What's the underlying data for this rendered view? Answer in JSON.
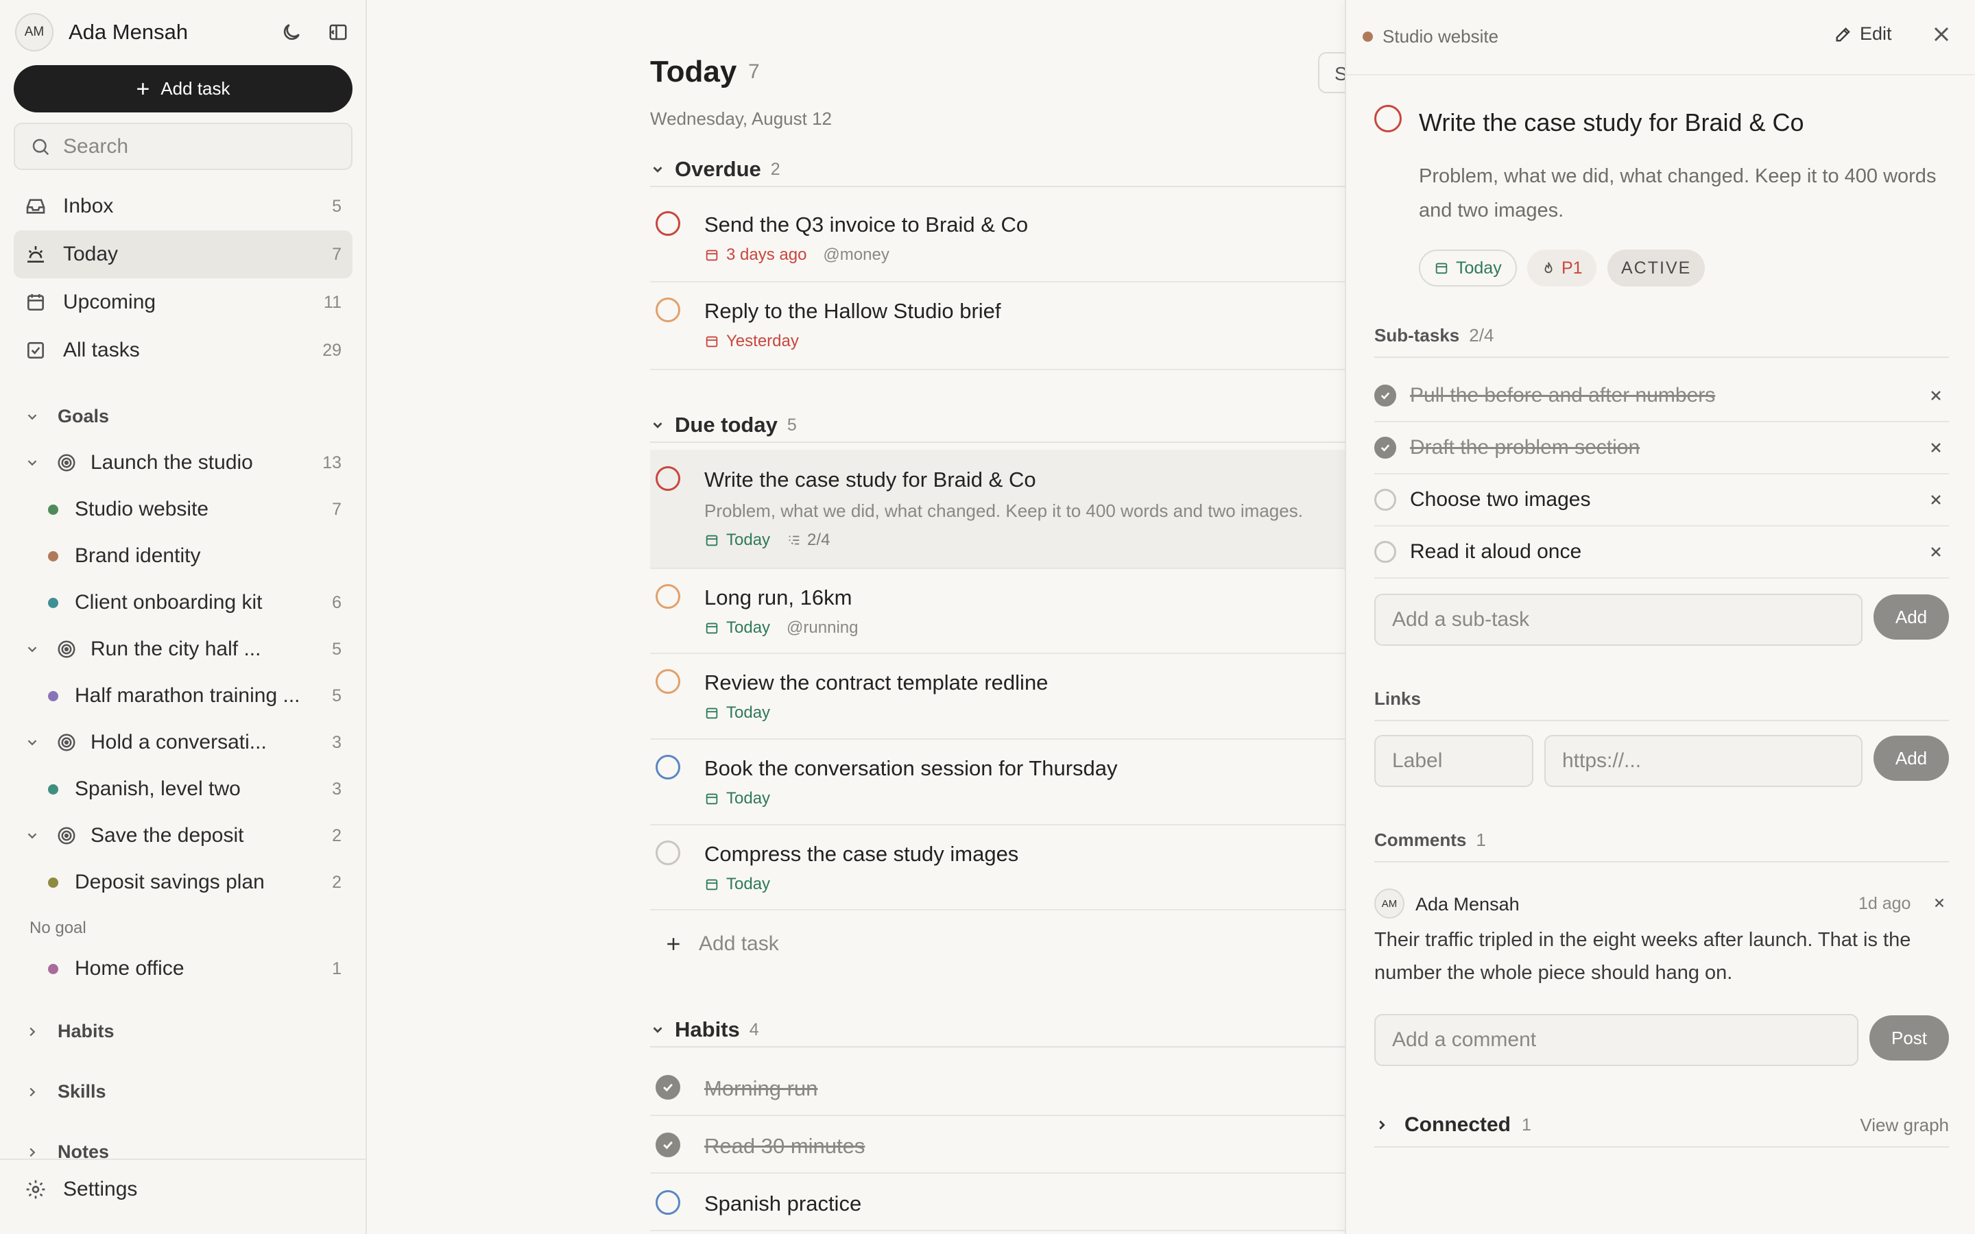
{
  "sidebar": {
    "user_initials": "AM",
    "user_name": "Ada Mensah",
    "add_task_label": "Add task",
    "search_placeholder": "Search",
    "nav": [
      {
        "label": "Inbox",
        "count": "5"
      },
      {
        "label": "Today",
        "count": "7"
      },
      {
        "label": "Upcoming",
        "count": "11"
      },
      {
        "label": "All tasks",
        "count": "29"
      }
    ],
    "goals_label": "Goals",
    "goals": [
      {
        "label": "Launch the studio",
        "count": "13",
        "projects": [
          {
            "label": "Studio website",
            "count": "7",
            "color": "#4f8a5b"
          },
          {
            "label": "Brand identity",
            "count": "",
            "color": "#b07a5a"
          },
          {
            "label": "Client onboarding kit",
            "count": "6",
            "color": "#3f8f94"
          }
        ]
      },
      {
        "label": "Run the city half ...",
        "count": "5",
        "projects": [
          {
            "label": "Half marathon training ...",
            "count": "5",
            "color": "#8a74b8"
          }
        ]
      },
      {
        "label": "Hold a conversati...",
        "count": "3",
        "projects": [
          {
            "label": "Spanish, level two",
            "count": "3",
            "color": "#3f8f80"
          }
        ]
      },
      {
        "label": "Save the deposit",
        "count": "2",
        "projects": [
          {
            "label": "Deposit savings plan",
            "count": "2",
            "color": "#8e8a3f"
          }
        ]
      }
    ],
    "no_goal_label": "No goal",
    "no_goal_projects": [
      {
        "label": "Home office",
        "count": "1",
        "color": "#a96b9a"
      }
    ],
    "habits_label": "Habits",
    "skills_label": "Skills",
    "notes_label": "Notes",
    "settings_label": "Settings"
  },
  "main": {
    "title": "Today",
    "count": "7",
    "date": "Wednesday, August 12",
    "top_button_label": "S",
    "groups": {
      "overdue": {
        "label": "Overdue",
        "count": "2"
      },
      "due_today": {
        "label": "Due today",
        "count": "5"
      },
      "habits": {
        "label": "Habits",
        "count": "4"
      }
    },
    "overdue_tasks": [
      {
        "title": "Send the Q3 invoice to Braid & Co",
        "date": "3 days ago",
        "tag": "@money"
      },
      {
        "title": "Reply to the Hallow Studio brief",
        "date": "Yesterday"
      }
    ],
    "today_tasks": [
      {
        "title": "Write the case study for Braid & Co",
        "desc": "Problem, what we did, what changed. Keep it to 400 words and two images.",
        "date": "Today",
        "subtasks": "2/4"
      },
      {
        "title": "Long run, 16km",
        "date": "Today",
        "tag": "@running"
      },
      {
        "title": "Review the contract template redline",
        "date": "Today"
      },
      {
        "title": "Book the conversation session for Thursday",
        "date": "Today"
      },
      {
        "title": "Compress the case study images",
        "date": "Today"
      }
    ],
    "add_task_label": "Add task",
    "habits": [
      {
        "title": "Morning run"
      },
      {
        "title": "Read 30 minutes"
      },
      {
        "title": "Spanish practice"
      }
    ]
  },
  "detail": {
    "project": "Studio website",
    "project_color": "#b07a5a",
    "edit_label": "Edit",
    "title": "Write the case study for Braid & Co",
    "description": "Problem, what we did, what changed. Keep it to 400 words and two images.",
    "chip_date": "Today",
    "chip_priority": "P1",
    "chip_status": "ACTIVE",
    "subtasks_label": "Sub-tasks",
    "subtasks_count": "2/4",
    "subtasks": [
      {
        "label": "Pull the before and after numbers",
        "done": true
      },
      {
        "label": "Draft the problem section",
        "done": true
      },
      {
        "label": "Choose two images",
        "done": false
      },
      {
        "label": "Read it aloud once",
        "done": false
      }
    ],
    "subtask_placeholder": "Add a sub-task",
    "subtask_add_label": "Add",
    "links_label": "Links",
    "link_label_placeholder": "Label",
    "link_url_placeholder": "https://...",
    "link_add_label": "Add",
    "comments_label": "Comments",
    "comments_count": "1",
    "comment": {
      "initials": "AM",
      "author": "Ada Mensah",
      "time": "1d ago",
      "text": "Their traffic tripled in the eight weeks after launch. That is the number the whole piece should hang on."
    },
    "comment_placeholder": "Add a comment",
    "post_label": "Post",
    "connected_label": "Connected",
    "connected_count": "1",
    "view_graph_label": "View graph"
  },
  "colors": {
    "overdue": "#c9463d",
    "today": "#2f7a58",
    "accent_dark": "#1f1f1f",
    "check_orange": "#e2a06a",
    "check_blue": "#5a86c4"
  },
  "icons": [
    "moon-icon",
    "sidebar-toggle-icon",
    "plus-icon",
    "search-icon",
    "inbox-icon",
    "today-icon",
    "calendar-icon",
    "check-square-icon",
    "chevron-down-icon",
    "chevron-right-icon",
    "target-icon",
    "gear-icon",
    "pencil-icon",
    "close-icon",
    "flame-icon",
    "subtask-icon",
    "check-icon"
  ]
}
